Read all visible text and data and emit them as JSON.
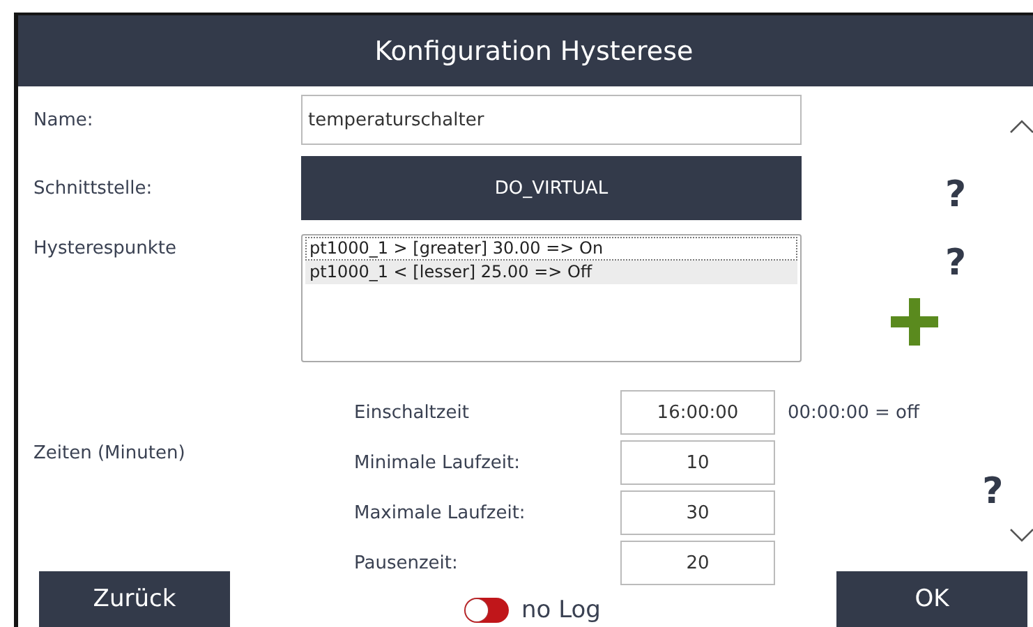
{
  "window": {
    "title": "Konfiguration Hysterese"
  },
  "name": {
    "label": "Name:",
    "value": "temperaturschalter"
  },
  "interface": {
    "label": "Schnittstelle:",
    "value": "DO_VIRTUAL",
    "help": "?"
  },
  "points": {
    "label": "Hysterespunkte",
    "help": "?",
    "items": [
      {
        "text": "pt1000_1 > [greater] 30.00 => On",
        "selected": false,
        "focused": true
      },
      {
        "text": "pt1000_1 < [lesser] 25.00 => Off",
        "selected": true,
        "focused": false
      }
    ]
  },
  "times": {
    "label": "Zeiten (Minuten)",
    "help": "?",
    "fields": [
      {
        "label": "Einschaltzeit",
        "value": "16:00:00",
        "note": "00:00:00 = off"
      },
      {
        "label": "Minimale Laufzeit:",
        "value": "10"
      },
      {
        "label": "Maximale Laufzeit:",
        "value": "30"
      },
      {
        "label": "Pausenzeit:",
        "value": "20"
      }
    ]
  },
  "log_toggle": {
    "label": "no Log",
    "on": false
  },
  "buttons": [
    {
      "label": "Zurück"
    },
    {
      "label": "OK"
    }
  ]
}
